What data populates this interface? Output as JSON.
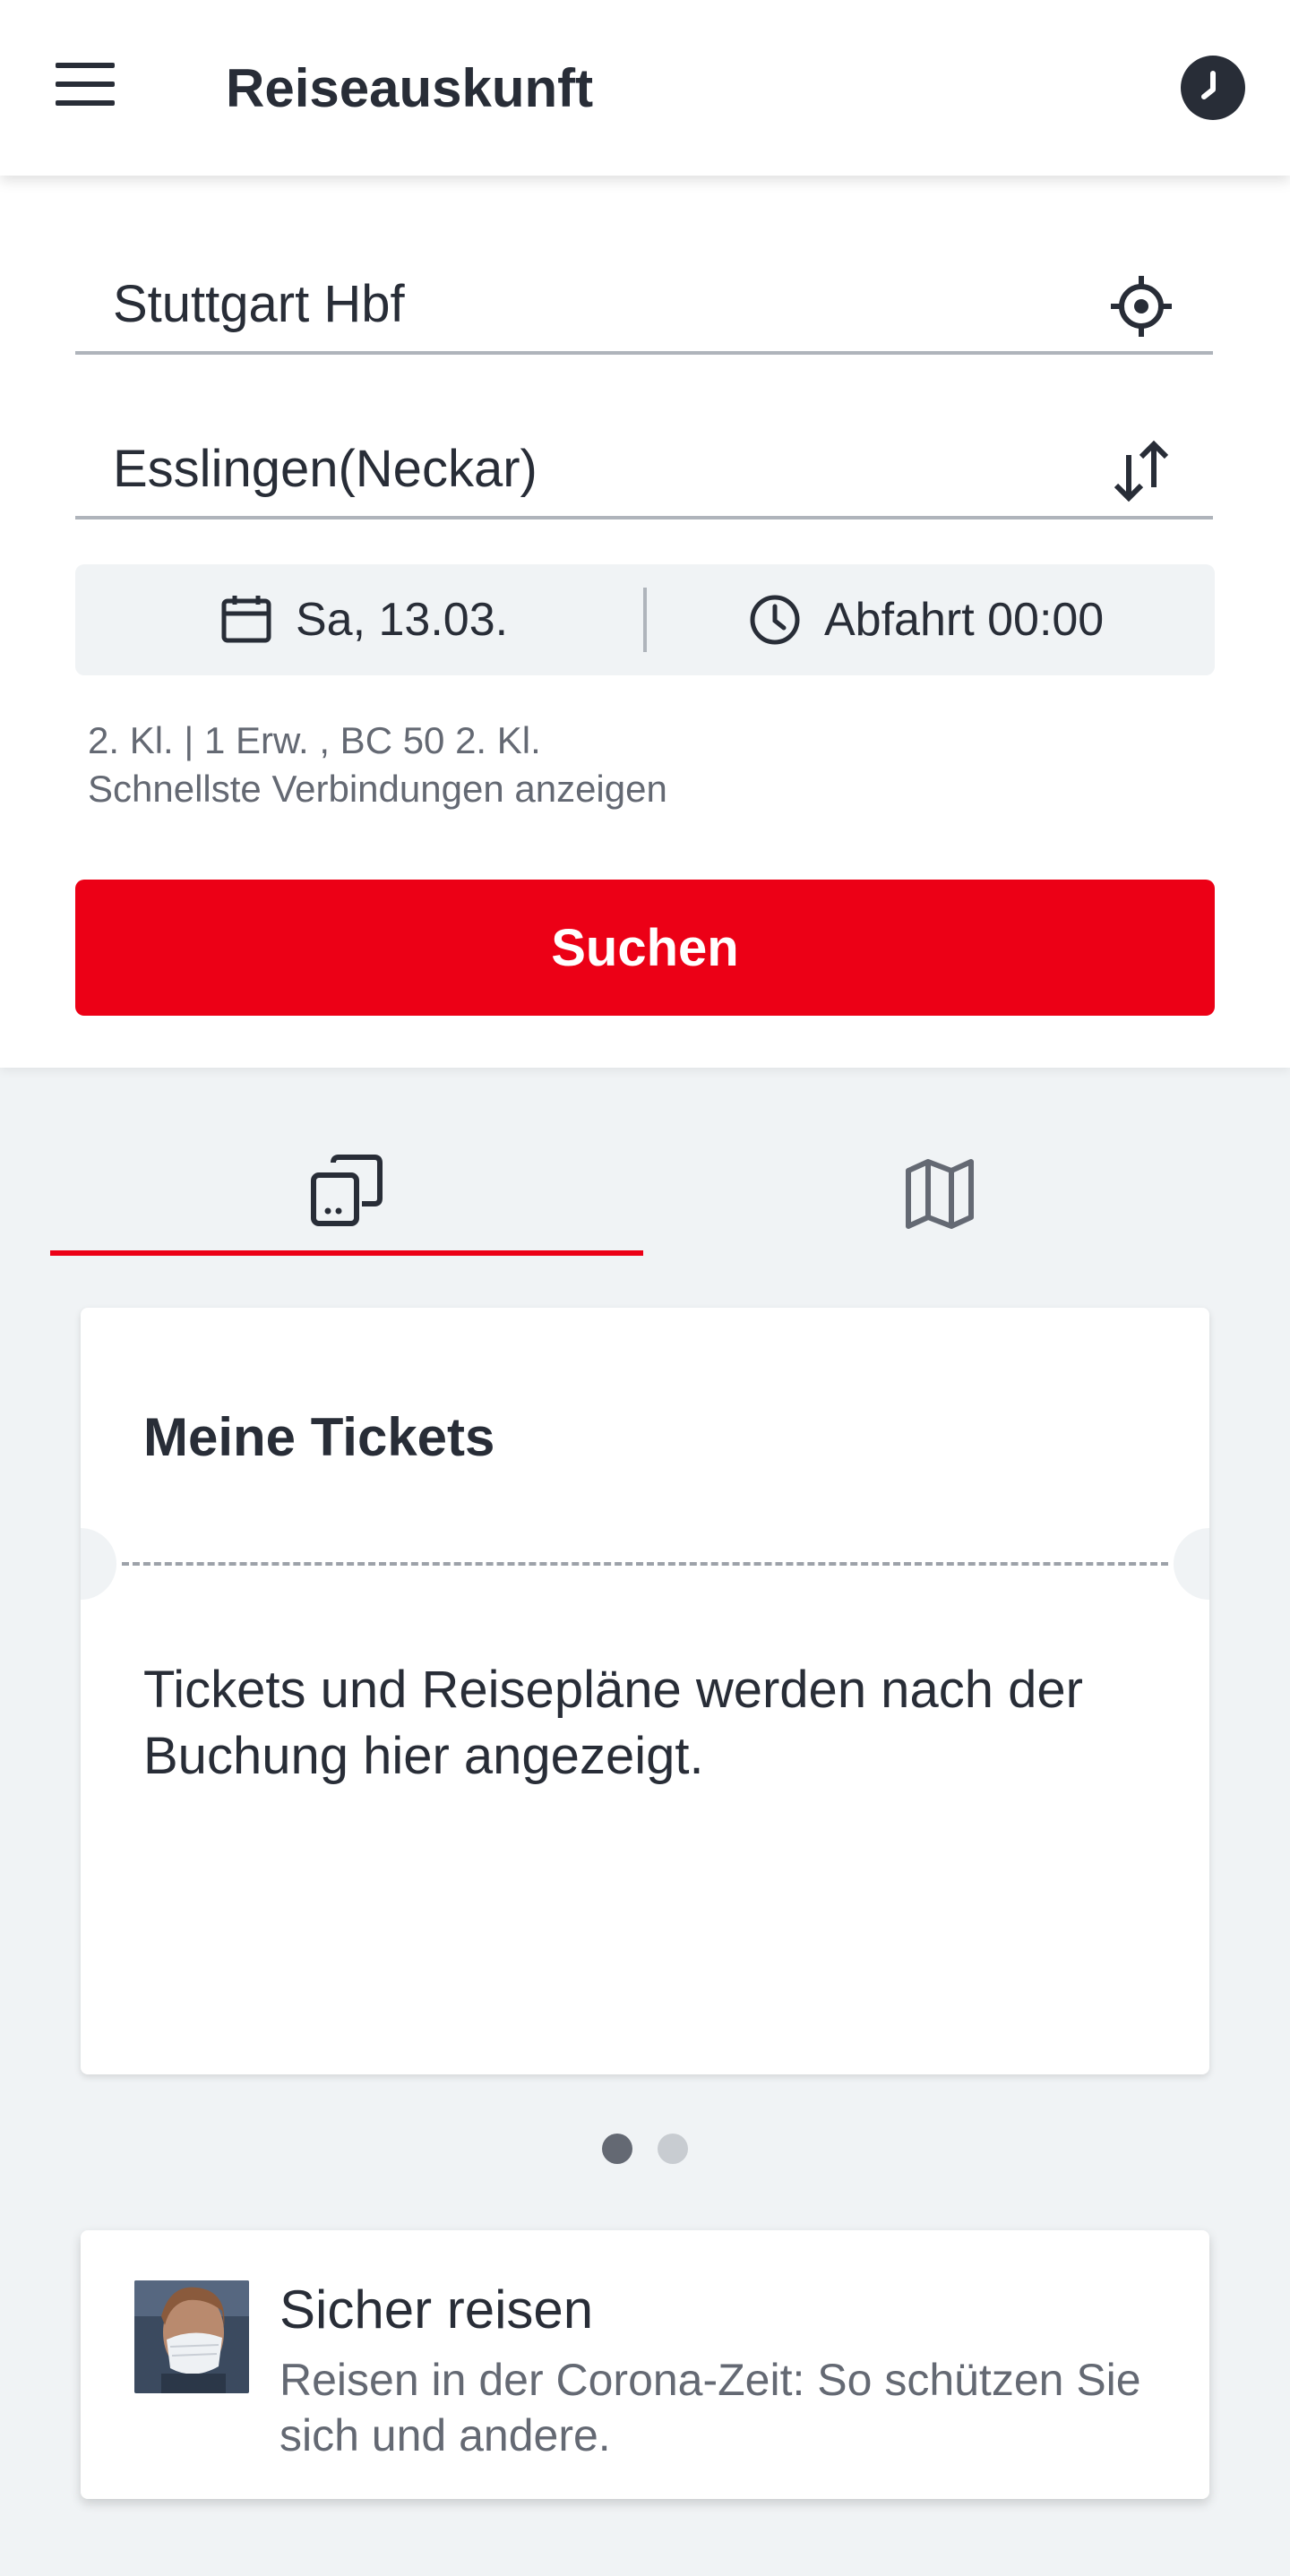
{
  "header": {
    "title": "Reiseauskunft",
    "menu_icon": "hamburger-menu-icon",
    "history_icon": "clock-history-icon"
  },
  "search": {
    "from_value": "Stuttgart Hbf",
    "to_value": "Esslingen(Neckar)",
    "location_icon": "crosshair-location-icon",
    "swap_icon": "swap-arrows-icon",
    "date": "Sa, 13.03.",
    "time": "Abfahrt 00:00",
    "options_line1": "2. Kl. | 1 Erw. , BC 50 2. Kl.",
    "options_line2": "Schnellste Verbindungen anzeigen",
    "search_button": "Suchen"
  },
  "tabs": [
    {
      "icon": "tickets-icon",
      "active": true
    },
    {
      "icon": "map-icon",
      "active": false
    }
  ],
  "tickets_card": {
    "heading": "Meine Tickets",
    "text": "Tickets und Reisepläne werden nach der Buchung hier angezeigt."
  },
  "pager": {
    "current": 1,
    "total": 2
  },
  "news": {
    "title": "Sicher reisen",
    "description": "Reisen in der Corona-Zeit: So schützen Sie sich und andere."
  },
  "colors": {
    "accent_red": "#ec0016",
    "text_dark": "#282d37",
    "text_muted": "#646973",
    "background": "#f0f3f5"
  }
}
